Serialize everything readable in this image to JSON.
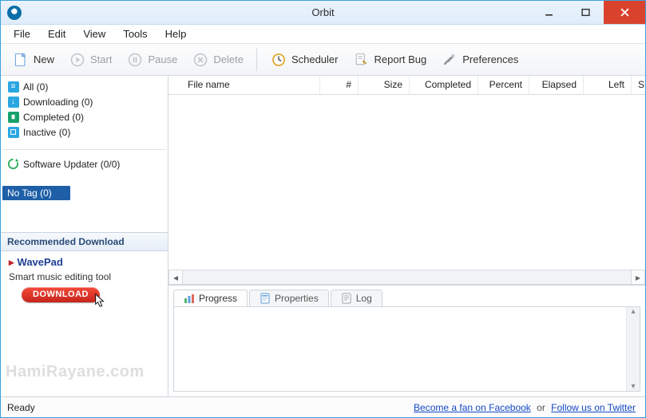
{
  "title": "Orbit",
  "menu": {
    "file": "File",
    "edit": "Edit",
    "view": "View",
    "tools": "Tools",
    "help": "Help"
  },
  "toolbar": {
    "new": "New",
    "start": "Start",
    "pause": "Pause",
    "delete": "Delete",
    "scheduler": "Scheduler",
    "report_bug": "Report Bug",
    "preferences": "Preferences"
  },
  "sidebar": {
    "items": [
      {
        "label": "All (0)"
      },
      {
        "label": "Downloading (0)"
      },
      {
        "label": "Completed (0)"
      },
      {
        "label": "Inactive (0)"
      }
    ],
    "updater": "Software Updater (0/0)",
    "notag": "No Tag (0)",
    "recommended_header": "Recommended Download",
    "reco_title": "WavePad",
    "reco_desc": "Smart music editing tool",
    "download_btn": "DOWNLOAD"
  },
  "columns": {
    "name": "File name",
    "hash": "#",
    "size": "Size",
    "completed": "Completed",
    "percent": "Percent",
    "elapsed": "Elapsed",
    "left": "Left",
    "speed": "S"
  },
  "tabs": {
    "progress": "Progress",
    "properties": "Properties",
    "log": "Log"
  },
  "status": {
    "ready": "Ready",
    "fb": "Become a fan on Facebook",
    "or": "or",
    "tw": "Follow us on Twitter"
  },
  "watermark": "HamiRayane.com"
}
